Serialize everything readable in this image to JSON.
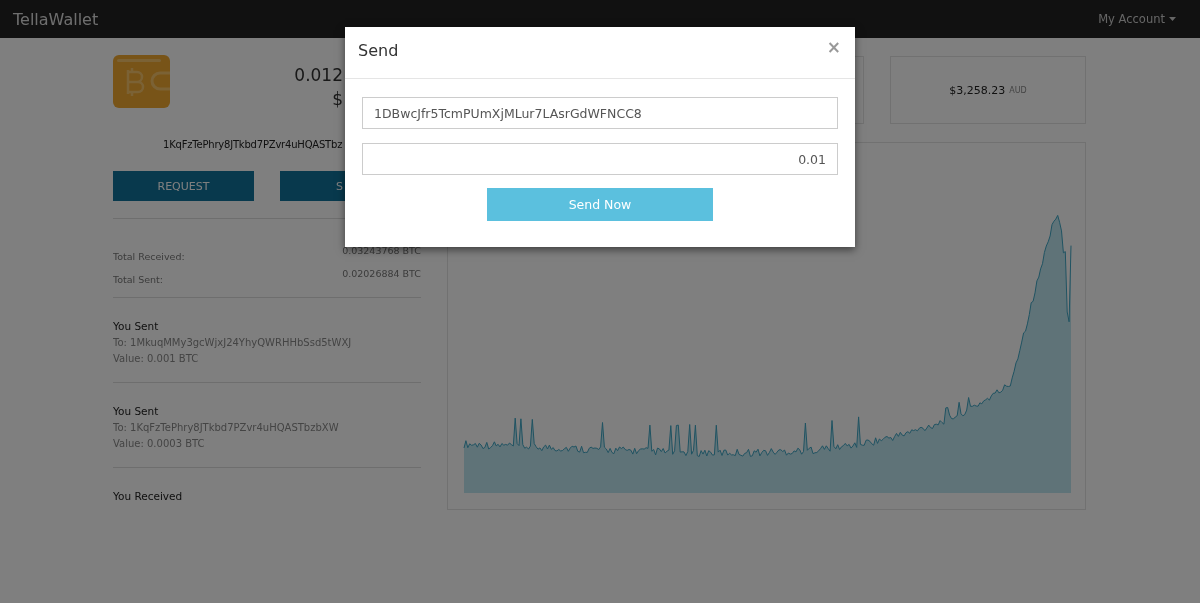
{
  "navbar": {
    "brand": "TellaWallet",
    "menu": "My Account"
  },
  "wallet": {
    "balance": "0.012",
    "fiat": "$",
    "address": "1KqFzTePhry8JTkbd7PZvr4uHQASTbz",
    "buttons": [
      "REQUEST",
      "S"
    ]
  },
  "totals": [
    {
      "label": "Total Received:",
      "value": "0.03243768 BTC"
    },
    {
      "label": "Total Sent:",
      "value": "0.02026884 BTC"
    }
  ],
  "transactions": [
    {
      "title": "You Sent",
      "to": "To: 1MkuqMMy3gcWjxJ24YhyQWRHHbSsd5tWXJ",
      "value": "Value: 0.001 BTC"
    },
    {
      "title": "You Sent",
      "to": "To: 1KqFzTePhry8JTkbd7PZvr4uHQASTbzbXW",
      "value": "Value: 0.0003 BTC"
    },
    {
      "title": "You Received"
    }
  ],
  "price_card": {
    "amount": "$3,258.23",
    "currency": "AUD"
  },
  "modal": {
    "title": "Send",
    "close": "×",
    "address": "1DBwcJfr5TcmPUmXjMLur7LAsrGdWFNCC8",
    "amount": "0.01",
    "button": "Send Now"
  }
}
